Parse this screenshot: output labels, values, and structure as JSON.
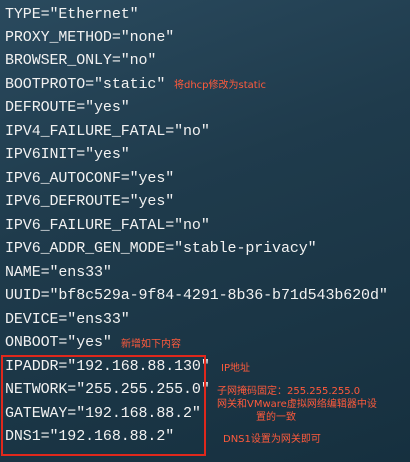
{
  "config_lines": [
    "TYPE=\"Ethernet\"",
    "PROXY_METHOD=\"none\"",
    "BROWSER_ONLY=\"no\"",
    "BOOTPROTO=\"static\"",
    "DEFROUTE=\"yes\"",
    "IPV4_FAILURE_FATAL=\"no\"",
    "IPV6INIT=\"yes\"",
    "IPV6_AUTOCONF=\"yes\"",
    "IPV6_DEFROUTE=\"yes\"",
    "IPV6_FAILURE_FATAL=\"no\"",
    "IPV6_ADDR_GEN_MODE=\"stable-privacy\"",
    "NAME=\"ens33\"",
    "UUID=\"bf8c529a-9f84-4291-8b36-b71d543b620d\"",
    "DEVICE=\"ens33\"",
    "ONBOOT=\"yes\"",
    "IPADDR=\"192.168.88.130\"",
    "NETWORK=\"255.255.255.0\"",
    "GATEWAY=\"192.168.88.2\"",
    "DNS1=\"192.168.88.2\""
  ],
  "annotations": {
    "bootproto_note": "将dhcp修改为static",
    "added_note": "新增如下内容",
    "ipaddr_note": "IP地址",
    "netmask_note_line1": "子网掩码固定：255.255.255.0",
    "netmask_note_line2": "网关和VMware虚拟网络编辑器中设",
    "netmask_note_line3": "置的一致",
    "dns_note": "DNS1设置为网关即可"
  },
  "colors": {
    "terminal_text": "#f2f2f2",
    "annotation_text": "#ff5a3c",
    "highlight_border": "#e0281c"
  }
}
